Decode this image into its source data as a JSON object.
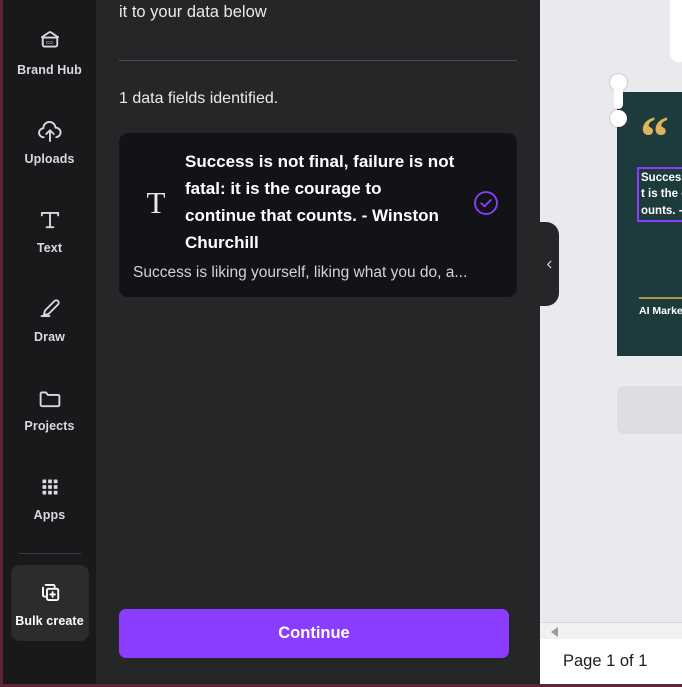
{
  "sidebar": {
    "items": [
      {
        "label": "Brand Hub",
        "icon": "brand-hub-icon",
        "active": false
      },
      {
        "label": "Uploads",
        "icon": "upload-cloud-icon",
        "active": false
      },
      {
        "label": "Text",
        "icon": "text-t-icon",
        "active": false
      },
      {
        "label": "Draw",
        "icon": "pencil-draw-icon",
        "active": false
      },
      {
        "label": "Projects",
        "icon": "folder-icon",
        "active": false
      },
      {
        "label": "Apps",
        "icon": "apps-grid-icon",
        "active": false
      },
      {
        "label": "Bulk create",
        "icon": "bulk-create-icon",
        "active": true
      }
    ],
    "brand_hub_badge_text": "CO."
  },
  "panel": {
    "heading_tail": "it to your data below",
    "fields_identified": "1 data fields identified.",
    "field_card": {
      "type_icon_glyph": "T",
      "title": "Success is not final, failure is not fatal: it is the courage to continue that counts. - Winston Churchill",
      "description": "Success is liking yourself, liking what you do, a...",
      "checked": true,
      "check_icon": "check-circle-icon"
    },
    "continue_label": "Continue"
  },
  "canvas": {
    "collapse_icon": "chevron-left-icon",
    "scroll_left_icon": "triangle-left-icon",
    "page_indicator": "Page 1 of 1",
    "design": {
      "quote_glyph": "“",
      "quote_text": "Success\nt is the c\nounts. -",
      "footer_label": "AI Marke"
    }
  },
  "colors": {
    "accent_purple": "#8b3dff",
    "rail_bg": "#18191b",
    "panel_bg": "#252627",
    "card_bg": "#121316",
    "canvas_bg": "#e8eaed",
    "design_bg": "#1d3b3c",
    "design_gold": "#dcb45c",
    "window_border": "#5d2336"
  }
}
